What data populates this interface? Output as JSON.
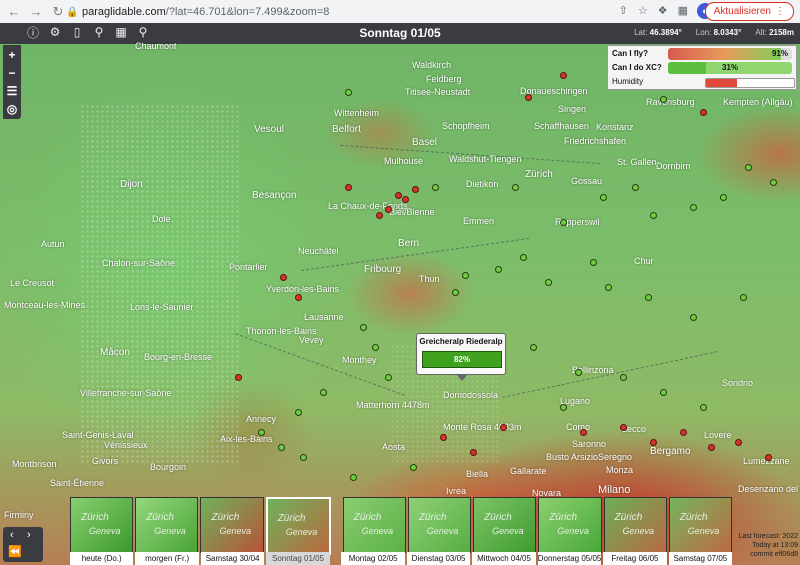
{
  "browser": {
    "url_host": "paraglidable.com",
    "url_rest": "/?lat=46.701&lon=7.499&zoom=8",
    "update_label": "Aktualisieren"
  },
  "app": {
    "title": "Sonntag 01/05",
    "lat_label": "Lat:",
    "lat_value": "46.3894°",
    "lon_label": "Lon:",
    "lon_value": "8.0343°",
    "alt_label": "Alt:",
    "alt_value": "2158m"
  },
  "panel": {
    "fly_label": "Can I fly?",
    "fly_value": "91%",
    "fly_fraction": 0.91,
    "xc_label": "Can I do XC?",
    "xc_value": "31%",
    "xc_fraction": 0.31,
    "humidity_label": "Humidity",
    "humidity_fraction": 0.35
  },
  "popup": {
    "title": "Greicheralp Riederalp",
    "value": "82%"
  },
  "places": [
    "Chaumont",
    "Waldkirch",
    "Feldberg",
    "Titisee-Neustadt",
    "Wittenheim",
    "Donaueschingen",
    "Ravensburg",
    "Kempten (Allgäu)",
    "Vesoul",
    "Belfort",
    "Basel",
    "Schopfheim",
    "Singen",
    "Schaffhausen",
    "Konstanz",
    "Friedrichshafen",
    "Mulhouse",
    "Waldshut-Tiengen",
    "Dietikon",
    "Zürich",
    "Gossau",
    "St. Gallen",
    "Dornbirn",
    "Dijon",
    "Besançon",
    "La Chaux-de-Fonds",
    "Biel/Bienne",
    "Rapperswil",
    "Emmen",
    "Bern",
    "Dole",
    "Autun",
    "Neuchâtel",
    "Pontarlier",
    "Fribourg",
    "Thun",
    "Chur",
    "Le Creusot",
    "Chalon-sur-Saône",
    "Yverdon-les-Bains",
    "Lausanne",
    "Montceau-les-Mines",
    "Lons-le-Saunier",
    "Thonon-les-Bains",
    "Vevey",
    "Mâcon",
    "Monthey",
    "Bourg-en-Bresse",
    "Bellinzona",
    "Villefranche-sur-Saône",
    "Annecy",
    "Aix-les-Bains",
    "Saint-Genis-Laval",
    "Vénissieux",
    "Givors",
    "Montbrison",
    "Bourgoin",
    "Saint-Étienne",
    "Firminy",
    "Aosta",
    "Biella",
    "Busto Arsizio",
    "Gallarate",
    "Saronno",
    "Seregno",
    "Monza",
    "Bergamo",
    "Lumezzane",
    "Desenzano del Garda",
    "Lecco",
    "Novara",
    "Ivrea",
    "Milano",
    "Lovere",
    "Monte Rosa 4633m",
    "Matterhorn 4478m",
    "Domodossola",
    "Sondrio",
    "Lugano",
    "Como"
  ],
  "days": [
    {
      "label": "heute (Do.)",
      "colors": [
        "#3d9a2c",
        "#86cf6f"
      ]
    },
    {
      "label": "morgen (Fr.)",
      "colors": [
        "#4aa437",
        "#93d77d"
      ]
    },
    {
      "label": "Samstag 30/04",
      "colors": [
        "#b8533a",
        "#6fb25b"
      ]
    },
    {
      "label": "Sonntag 01/05",
      "colors": [
        "#b9693e",
        "#6fb25b"
      ]
    },
    {
      "label": "Montag 02/05",
      "colors": [
        "#5ab246",
        "#8bcc72"
      ]
    },
    {
      "label": "Dienstag 03/05",
      "colors": [
        "#57ad44",
        "#8fd075"
      ]
    },
    {
      "label": "Mittwoch 04/05",
      "colors": [
        "#3f9c31",
        "#7cc465"
      ]
    },
    {
      "label": "Donnerstag 05/05",
      "colors": [
        "#4aa83a",
        "#8bd06f"
      ]
    },
    {
      "label": "Freitag 06/05",
      "colors": [
        "#b86a42",
        "#6cae58"
      ]
    },
    {
      "label": "Samstag 07/05",
      "colors": [
        "#bd6a42",
        "#74b55c"
      ]
    }
  ],
  "mini_text": "Zürich",
  "mini_text2": "Geneva",
  "commit": {
    "line1": "Last forecast: 2022",
    "line2": "Today at 13:09",
    "line3": "commit eff06d8"
  }
}
